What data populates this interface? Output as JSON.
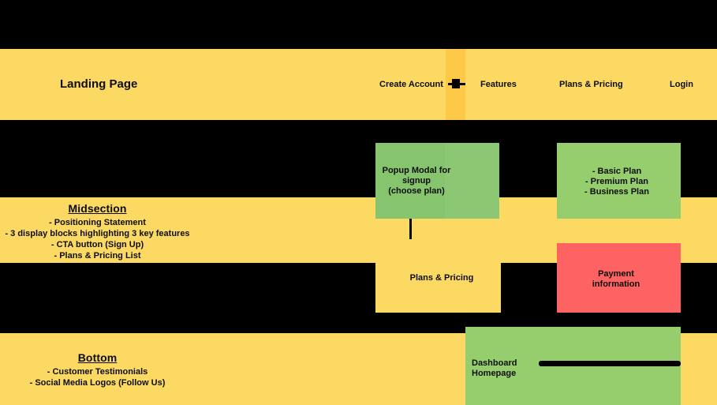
{
  "diagram": {
    "colors": {
      "background": "#000000",
      "band_yellow": "#FCD962",
      "accent_yellow": "#FDC946",
      "green": "#97CE6D",
      "green_dark": "#86C46E",
      "red": "#FC6362",
      "text": "#0D0D0D"
    }
  },
  "landing": {
    "heading": "Landing Page",
    "nav": [
      {
        "label": "Create Account"
      },
      {
        "label": "Features"
      },
      {
        "label": "Plans & Pricing"
      },
      {
        "label": "Login"
      }
    ]
  },
  "midsection": {
    "title": "Midsection",
    "lines": [
      "- Positioning Statement",
      "- 3 display blocks highlighting 3 key features",
      "- CTA button (Sign Up)",
      "- Plans & Pricing List"
    ]
  },
  "bottom": {
    "title": "Bottom",
    "lines": [
      "- Customer Testimonials",
      "- Social Media Logos (Follow Us)"
    ]
  },
  "nodes": {
    "popup_modal": "Popup Modal for\nsignup\n(choose plan)",
    "plans_list": "- Basic Plan\n- Premium Plan\n- Business Plan",
    "plans_pricing": "Plans & Pricing",
    "payment": "Payment\ninformation",
    "dashboard": "Dashboard\nHomepage"
  }
}
